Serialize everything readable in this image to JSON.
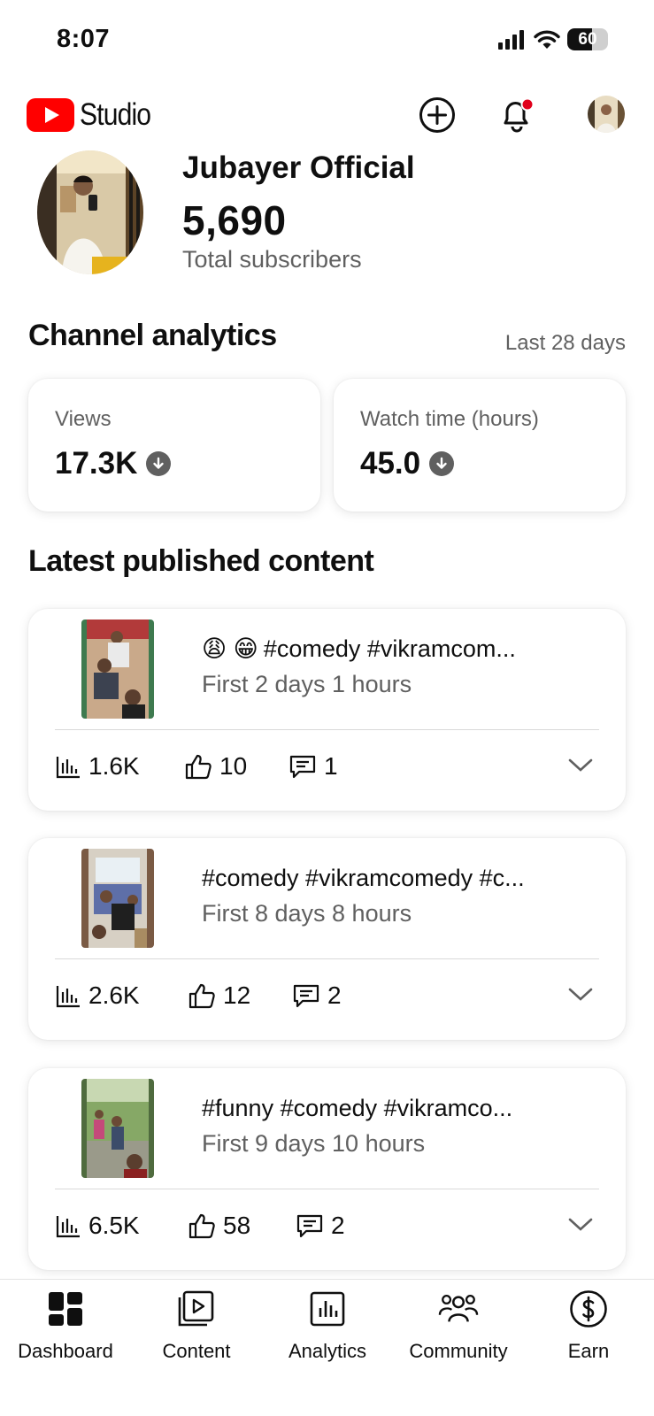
{
  "status_bar": {
    "time": "8:07",
    "battery": "60",
    "battery_level": 0.6
  },
  "header": {
    "logo_text": "Studio",
    "icons": [
      "create-icon",
      "notification-bell-icon",
      "account-avatar"
    ],
    "brand_color": "#ff0000"
  },
  "channel": {
    "name": "Jubayer Official",
    "subscribers": "5,690",
    "subscribers_label": "Total subscribers"
  },
  "analytics": {
    "title": "Channel analytics",
    "period": "Last 28 days",
    "cards": [
      {
        "label": "Views",
        "value": "17.3K"
      },
      {
        "label": "Watch time (hours)",
        "value": "45.0"
      }
    ]
  },
  "latest": {
    "title": "Latest published content",
    "videos": [
      {
        "emoji": "😩 😁",
        "title": "#comedy #vikramcom...",
        "age": "First 2 days 1 hours",
        "views": "1.6K",
        "likes": "10",
        "comments": "1"
      },
      {
        "emoji": "",
        "title": "#comedy #vikramcomedy #c...",
        "age": "First 8 days 8 hours",
        "views": "2.6K",
        "likes": "12",
        "comments": "2"
      },
      {
        "emoji": "",
        "title": "#funny #comedy #vikramco...",
        "age": "First 9 days 10 hours",
        "views": "6.5K",
        "likes": "58",
        "comments": "2"
      }
    ]
  },
  "nav": {
    "items": [
      {
        "label": "Dashboard",
        "icon": "dashboard-icon"
      },
      {
        "label": "Content",
        "icon": "content-icon"
      },
      {
        "label": "Analytics",
        "icon": "analytics-icon"
      },
      {
        "label": "Community",
        "icon": "community-icon"
      },
      {
        "label": "Earn",
        "icon": "earn-icon"
      }
    ]
  }
}
